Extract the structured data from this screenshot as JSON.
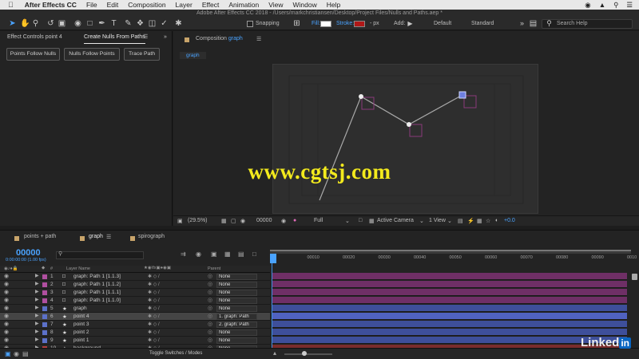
{
  "menubar": {
    "app": "After Effects CC",
    "items": [
      "File",
      "Edit",
      "Composition",
      "Layer",
      "Effect",
      "Animation",
      "View",
      "Window",
      "Help"
    ]
  },
  "window_title": "Adobe After Effects CC 2018 - /Users/markchristiansen/Desktop/Project Files/Nulls and Paths.aep *",
  "toolbar": {
    "snapping": "Snapping",
    "fill": "Fill:",
    "stroke": "Stroke:",
    "stroke_px": "- px",
    "add": "Add:",
    "workspace_default": "Default",
    "workspace_standard": "Standard",
    "search_placeholder": "Search Help",
    "fill_color": "#ffffff",
    "stroke_color": "#b01818",
    "accent": "#4aa3ff"
  },
  "left_panel": {
    "tab_effect_controls": "Effect Controls point 4",
    "tab_create_nulls": "Create Nulls From Paths",
    "buttons": [
      "Points Follow Nulls",
      "Nulls Follow Points",
      "Trace Path"
    ]
  },
  "comp_panel": {
    "title_prefix": "Composition",
    "comp_name": "graph",
    "breadcrumb": "graph"
  },
  "viewer": {
    "zoom": "(29.5%)",
    "timecode": "00000",
    "resolution": "Full",
    "camera": "Active Camera",
    "views": "1 View",
    "exposure": "+0.0"
  },
  "watermark": "www.cgtsj.com",
  "timeline": {
    "tabs": [
      "points + path",
      "graph",
      "spirograph"
    ],
    "current_time": "00000",
    "fps": "0:00:00:00 (1.00 fps)",
    "col_layer_name": "Layer Name",
    "col_parent": "Parent",
    "ruler": [
      "00",
      "00010",
      "00020",
      "00030",
      "00040",
      "00050",
      "00060",
      "00070",
      "00080",
      "00090",
      "0010"
    ],
    "layers": [
      {
        "num": "1",
        "name": "graph: Path 1 [1.1.3]",
        "parent": "None",
        "color": "#b04fa0"
      },
      {
        "num": "2",
        "name": "graph: Path 1 [1.1.2]",
        "parent": "None",
        "color": "#b04fa0"
      },
      {
        "num": "3",
        "name": "graph: Path 1 [1.1.1]",
        "parent": "None",
        "color": "#b04fa0"
      },
      {
        "num": "4",
        "name": "graph: Path 1 [1.1.0]",
        "parent": "None",
        "color": "#b04fa0"
      },
      {
        "num": "5",
        "name": "graph",
        "parent": "None",
        "color": "#5c71c9"
      },
      {
        "num": "6",
        "name": "point 4",
        "parent": "1. graph: Path",
        "color": "#5c71c9"
      },
      {
        "num": "7",
        "name": "point 3",
        "parent": "2. graph: Path",
        "color": "#5c71c9"
      },
      {
        "num": "8",
        "name": "point 2",
        "parent": "None",
        "color": "#5c71c9"
      },
      {
        "num": "9",
        "name": "point 1",
        "parent": "None",
        "color": "#5c71c9"
      },
      {
        "num": "10",
        "name": "background",
        "parent": "None",
        "color": "#b44040"
      }
    ],
    "toggle_label": "Toggle Switches / Modes"
  },
  "brand": {
    "text": "Linked",
    "badge": "in"
  }
}
